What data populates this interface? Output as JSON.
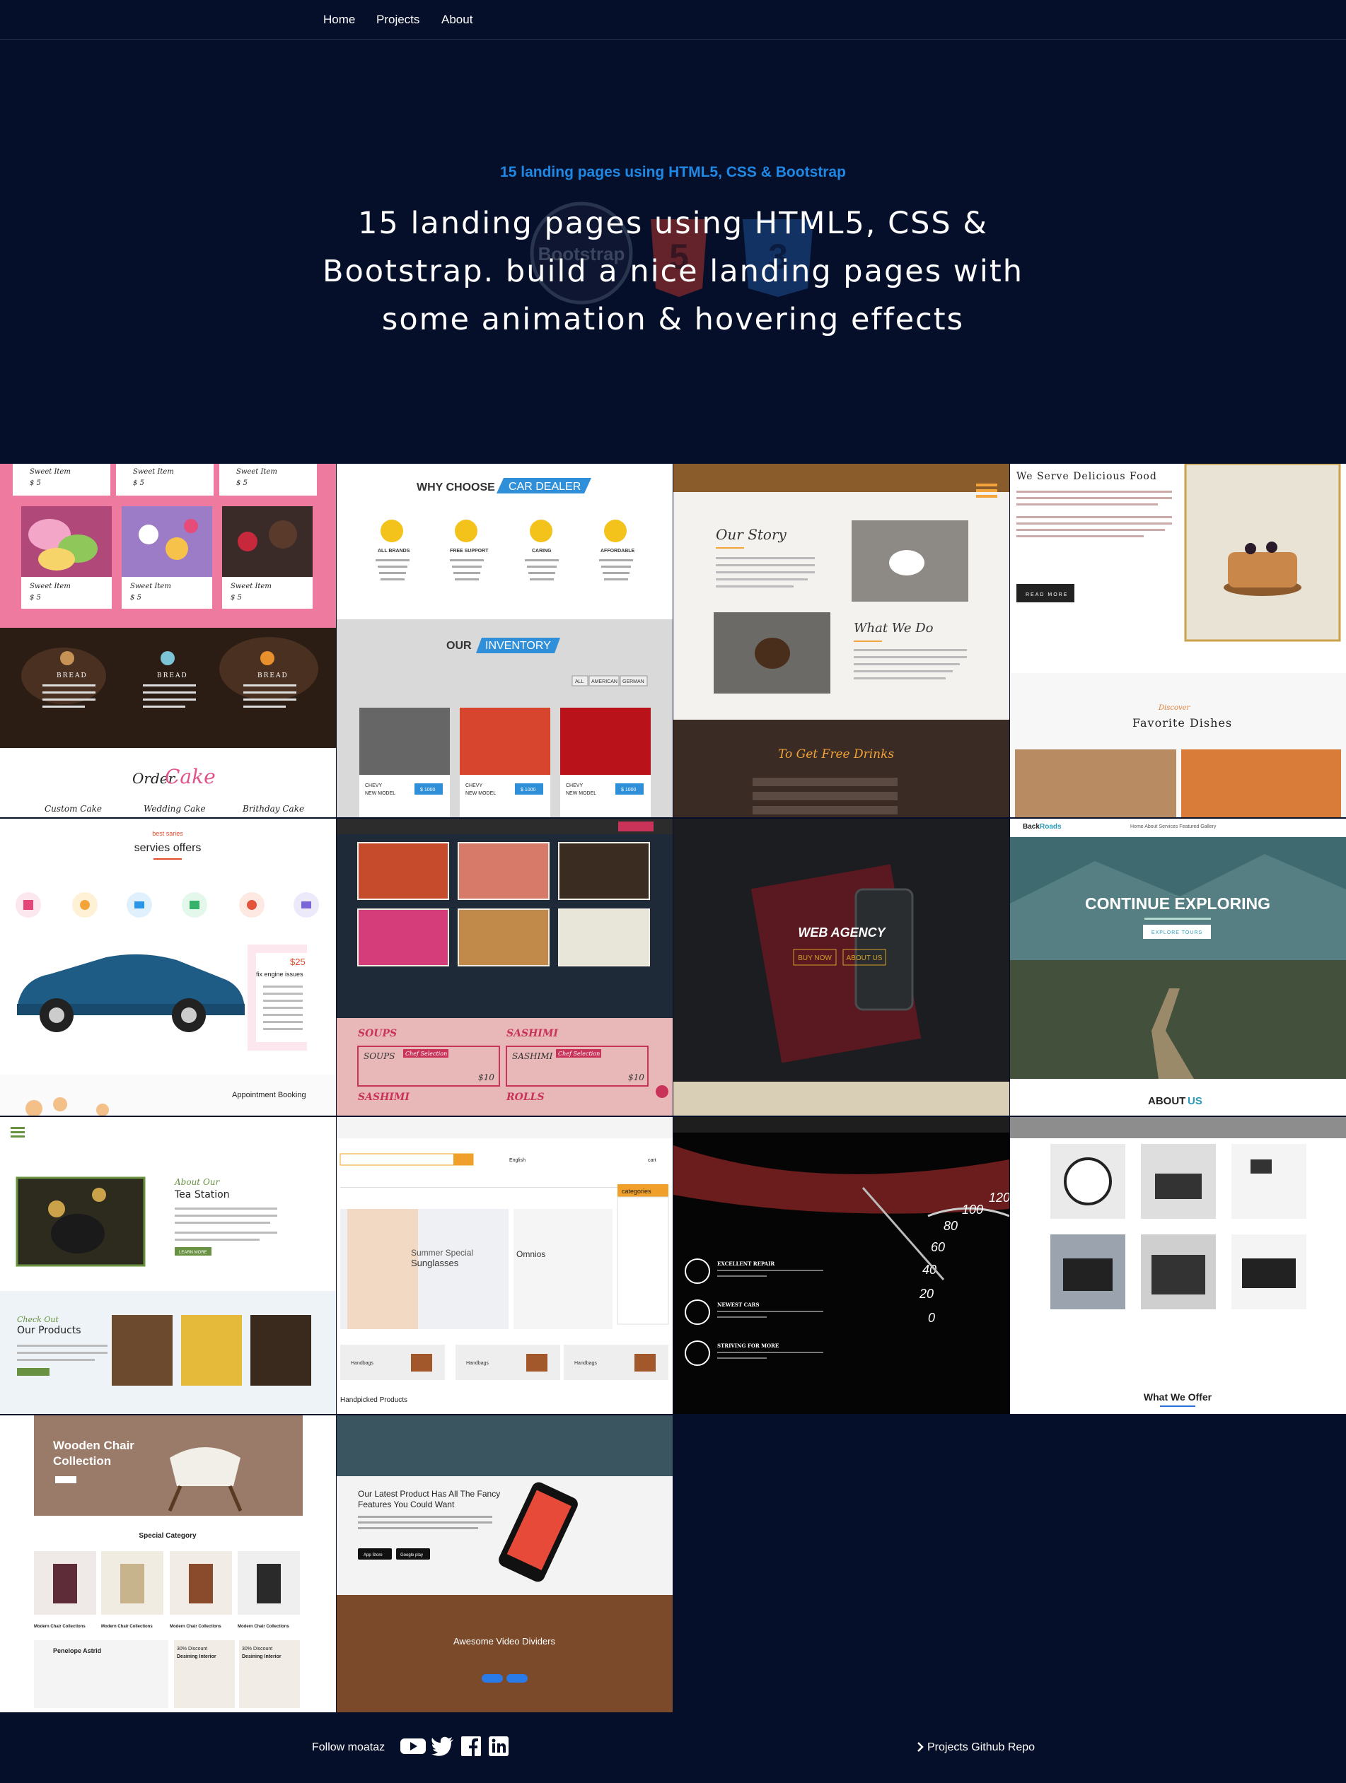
{
  "nav": {
    "home": "Home",
    "projects": "Projects",
    "about": "About"
  },
  "hero": {
    "subtitle": "15 landing pages using HTML5, CSS & Bootstrap",
    "title": "15 landing pages using HTML5, CSS & Bootstrap. build a nice landing pages with some animation & hovering effects",
    "bootstrap_logo_text": "Bootstrap"
  },
  "projects": [
    {
      "name": "cake-shop",
      "texts": {
        "item": "Sweet Item",
        "price": "$ 5",
        "bread": "BREAD",
        "order": "Order",
        "cake": "Cake",
        "custom": "Custom Cake",
        "wedding": "Wedding Cake",
        "birthday": "Brithday Cake"
      }
    },
    {
      "name": "car-dealer",
      "texts": {
        "why": "WHY CHOOSE",
        "dealer": "CAR DEALER",
        "brands": "ALL BRANDS",
        "support": "FREE SUPPORT",
        "caring": "CARING",
        "affordable": "AFFORDABLE",
        "our": "OUR",
        "inventory": "INVENTORY",
        "all": "ALL",
        "american": "AMERICAN",
        "german": "GERMAN",
        "chevy": "CHEVY",
        "model": "NEW MODEL",
        "price": "$ 1000"
      }
    },
    {
      "name": "coffee-story",
      "texts": {
        "story": "Our Story",
        "dream": "What We Do",
        "drinks": "To Get Free Drinks"
      }
    },
    {
      "name": "delicious-food",
      "texts": {
        "serve": "We Serve Delicious Food",
        "read": "READ MORE",
        "discover": "Discover",
        "favorite": "Favorite Dishes"
      }
    },
    {
      "name": "car-services",
      "texts": {
        "best": "best saries",
        "offers": "servies offers",
        "price": "$25",
        "engine": "fix engine issues",
        "appointment": "Appointment Booking"
      }
    },
    {
      "name": "sushi",
      "texts": {
        "soups": "SOUPS",
        "sashimi": "SASHIMI",
        "rolls": "ROLLS",
        "price": "$10",
        "chef": "Chef Selection"
      }
    },
    {
      "name": "web-agency",
      "texts": {
        "title": "WEB AGENCY",
        "buy": "BUY NOW",
        "about": "ABOUT US"
      }
    },
    {
      "name": "backroads",
      "texts": {
        "brand_a": "Back",
        "brand_b": "Roads",
        "nav": "Home About Services Featured Gallery",
        "title": "CONTINUE EXPLORING",
        "explore": "EXPLORE TOURS",
        "about_a": "ABOUT",
        "about_b": "US"
      }
    },
    {
      "name": "tea-station",
      "texts": {
        "about": "About Our",
        "station": "Tea Station",
        "check": "Check Out",
        "products": "Our Products",
        "learn": "LEARN MORE"
      }
    },
    {
      "name": "e-shop",
      "texts": {
        "categories": "categories",
        "summer": "Summer Special",
        "sunglasses": "Sunglasses",
        "omnios": "Omnios",
        "handbags": "Handbags",
        "handpicked": "Handpicked Products",
        "english": "English",
        "cart": "cart"
      }
    },
    {
      "name": "car-repair",
      "texts": {
        "repair": "EXCELLENT REPAIR",
        "newest": "NEWEST CARS",
        "striving": "STRIVING FOR MORE"
      }
    },
    {
      "name": "camera-gallery",
      "texts": {
        "offer": "What We Offer"
      }
    },
    {
      "name": "wooden-chair",
      "texts": {
        "title1": "Wooden Chair",
        "title2": "Collection",
        "special": "Special Category",
        "collection": "Modern Chair Collections",
        "penelope": "Penelope Astrid",
        "discount": "30% Discount",
        "desining": "Desining Interior"
      }
    },
    {
      "name": "app-landing",
      "texts": {
        "latest1": "Our Latest Product Has All The Fancy",
        "latest2": "Features You Could Want",
        "app_store": "App Store",
        "google_play": "Google play",
        "dividers": "Awesome Video Dividers"
      }
    }
  ],
  "footer": {
    "follow": "Follow moataz",
    "social_icons": [
      "youtube-icon",
      "twitter-icon",
      "facebook-icon",
      "linkedin-icon"
    ],
    "repo": "Projects Github Repo"
  },
  "colors": {
    "background": "#060f2a",
    "accent": "#1e88e5"
  }
}
